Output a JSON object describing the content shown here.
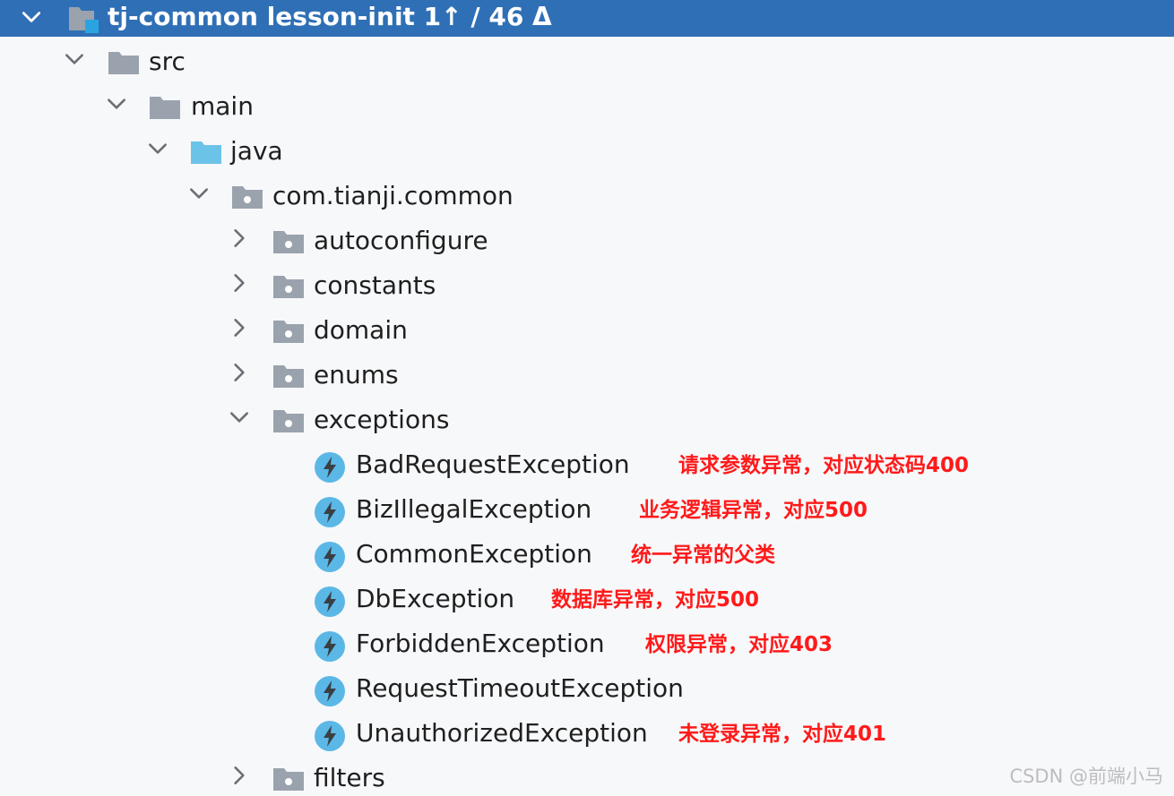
{
  "tree": {
    "root": {
      "label": "tj-common  lesson-init 1↑ / 46 Δ",
      "expanded": true
    },
    "src": {
      "label": "src",
      "expanded": true
    },
    "main": {
      "label": "main",
      "expanded": true
    },
    "java": {
      "label": "java",
      "expanded": true
    },
    "package": {
      "label": "com.tianji.common",
      "expanded": true
    },
    "autoconfigure": {
      "label": "autoconfigure",
      "expanded": false
    },
    "constants": {
      "label": "constants",
      "expanded": false
    },
    "domain": {
      "label": "domain",
      "expanded": false
    },
    "enums": {
      "label": "enums",
      "expanded": false
    },
    "exceptions": {
      "label": "exceptions",
      "expanded": true
    },
    "classes": [
      {
        "label": "BadRequestException",
        "note": "请求参数异常，对应状态码400"
      },
      {
        "label": "BizIllegalException",
        "note": "业务逻辑异常，对应500"
      },
      {
        "label": "CommonException",
        "note": "统一异常的父类"
      },
      {
        "label": "DbException",
        "note": "数据库异常，对应500"
      },
      {
        "label": "ForbiddenException",
        "note": "权限异常，对应403"
      },
      {
        "label": "RequestTimeoutException",
        "note": ""
      },
      {
        "label": "UnauthorizedException",
        "note": "未登录异常，对应401"
      }
    ],
    "filters": {
      "label": "filters",
      "expanded": false
    }
  },
  "watermark": "CSDN @前端小马",
  "colors": {
    "selection": "#2f6fb6",
    "folder_gray": "#9aa3ad",
    "source_folder": "#6cc3e8",
    "class_icon": "#5bb8e6",
    "note_red": "#ff1a1a"
  },
  "icons": {
    "expanded": "chevron-down-icon",
    "collapsed": "chevron-right-icon",
    "module": "module-folder-icon",
    "folder": "folder-icon",
    "source_root": "source-root-folder-icon",
    "package": "package-folder-icon",
    "exception_class": "exception-class-icon"
  }
}
